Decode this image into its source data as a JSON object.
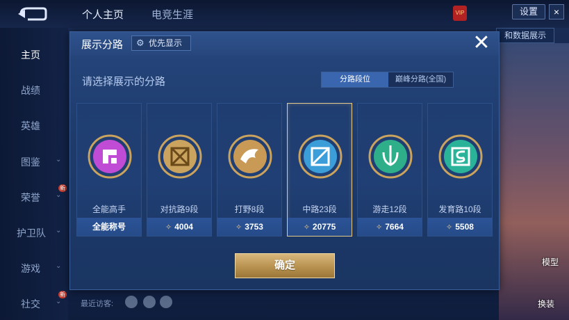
{
  "topbar": {
    "tab_profile": "个人主页",
    "tab_esports": "电竞生涯",
    "settings_label": "设置",
    "close_label": "×",
    "vip_label": "VIP",
    "data_display_label": "和数据展示"
  },
  "sidebar": {
    "items": [
      {
        "label": "主页"
      },
      {
        "label": "战绩"
      },
      {
        "label": "英雄"
      },
      {
        "label": "图鉴"
      },
      {
        "label": "荣誉"
      },
      {
        "label": "护卫队"
      },
      {
        "label": "游戏"
      },
      {
        "label": "社交"
      }
    ],
    "new_tag": "新",
    "recent_visitors": "最近访客:"
  },
  "right_side": {
    "label1": "模型",
    "label2": "换装"
  },
  "modal": {
    "title": "展示分路",
    "priority_label": "优先显示",
    "close_label": "✕",
    "subtitle": "请选择展示的分路",
    "tabs": [
      {
        "label": "分路段位",
        "active": true
      },
      {
        "label": "巅峰分路(全国)",
        "active": false
      }
    ],
    "cards": [
      {
        "rank": "全能高手",
        "value": "全能称号",
        "icon": "all-round-emblem-icon",
        "color": "#c04cd6",
        "selected": false
      },
      {
        "rank": "对抗路9段",
        "value": "4004",
        "icon": "clash-lane-emblem-icon",
        "color": "#caa35e",
        "selected": false
      },
      {
        "rank": "打野8段",
        "value": "3753",
        "icon": "jungle-emblem-icon",
        "color": "#c99a55",
        "selected": false
      },
      {
        "rank": "中路23段",
        "value": "20775",
        "icon": "mid-lane-emblem-icon",
        "color": "#3b9ed9",
        "selected": true
      },
      {
        "rank": "游走12段",
        "value": "7664",
        "icon": "roam-emblem-icon",
        "color": "#2fae8a",
        "selected": false
      },
      {
        "rank": "发育路10段",
        "value": "5508",
        "icon": "farm-lane-emblem-icon",
        "color": "#2bb39a",
        "selected": false
      }
    ],
    "confirm_label": "确定"
  }
}
